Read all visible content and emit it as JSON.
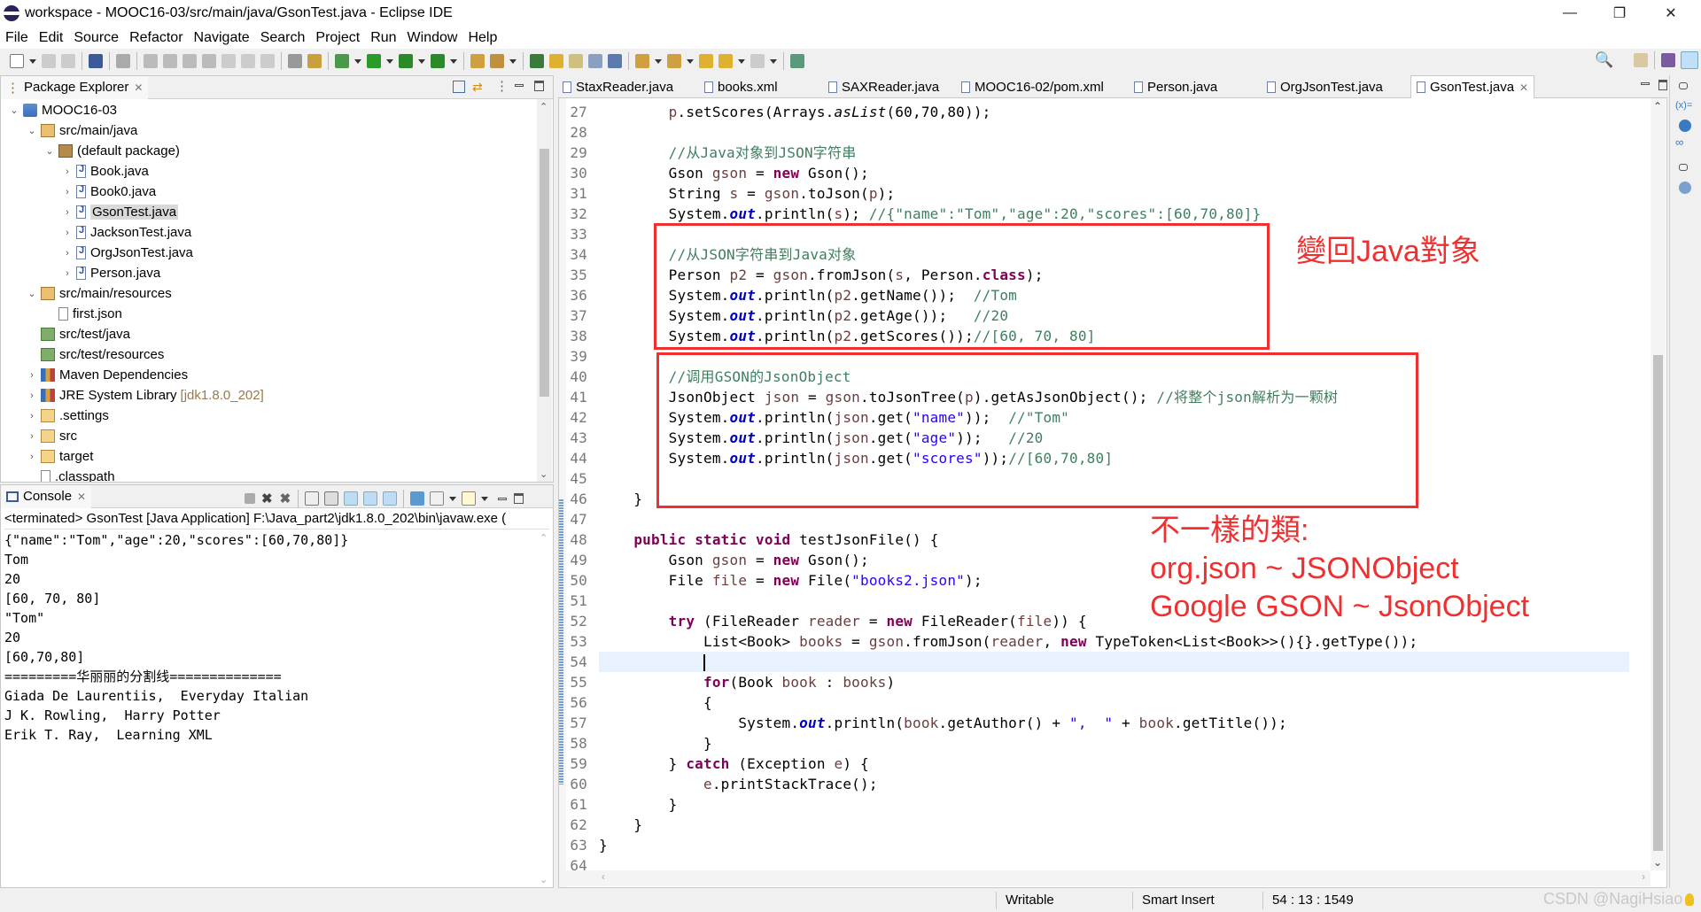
{
  "window": {
    "title": "workspace - MOOC16-03/src/main/java/GsonTest.java - Eclipse IDE",
    "minimize": "—",
    "restore": "❐",
    "close": "✕"
  },
  "menu": [
    "File",
    "Edit",
    "Source",
    "Refactor",
    "Navigate",
    "Search",
    "Project",
    "Run",
    "Window",
    "Help"
  ],
  "package_explorer": {
    "title": "Package Explorer",
    "tree": [
      {
        "label": "MOOC16-03",
        "level": 0,
        "chev": "v",
        "icon": "proj"
      },
      {
        "label": "src/main/java",
        "level": 1,
        "chev": "v",
        "icon": "pkgfolder"
      },
      {
        "label": "(default package)",
        "level": 2,
        "chev": "v",
        "icon": "pkg"
      },
      {
        "label": "Book.java",
        "level": 3,
        "chev": ">",
        "icon": "java"
      },
      {
        "label": "Book0.java",
        "level": 3,
        "chev": ">",
        "icon": "java"
      },
      {
        "label": "GsonTest.java",
        "level": 3,
        "chev": ">",
        "icon": "java",
        "selected": true
      },
      {
        "label": "JacksonTest.java",
        "level": 3,
        "chev": ">",
        "icon": "java"
      },
      {
        "label": "OrgJsonTest.java",
        "level": 3,
        "chev": ">",
        "icon": "java"
      },
      {
        "label": "Person.java",
        "level": 3,
        "chev": ">",
        "icon": "java"
      },
      {
        "label": "src/main/resources",
        "level": 1,
        "chev": "v",
        "icon": "pkgfolder"
      },
      {
        "label": "first.json",
        "level": 2,
        "chev": "",
        "icon": "file"
      },
      {
        "label": "src/test/java",
        "level": 1,
        "chev": "",
        "icon": "testfolder"
      },
      {
        "label": "src/test/resources",
        "level": 1,
        "chev": "",
        "icon": "testfolder"
      },
      {
        "label": "Maven Dependencies",
        "level": 1,
        "chev": ">",
        "icon": "lib"
      },
      {
        "label": "JRE System Library",
        "suffix": "[jdk1.8.0_202]",
        "level": 1,
        "chev": ">",
        "icon": "lib"
      },
      {
        "label": ".settings",
        "level": 1,
        "chev": ">",
        "icon": "folder"
      },
      {
        "label": "src",
        "level": 1,
        "chev": ">",
        "icon": "folder"
      },
      {
        "label": "target",
        "level": 1,
        "chev": ">",
        "icon": "folder"
      },
      {
        "label": ".classpath",
        "level": 1,
        "chev": "",
        "icon": "file"
      }
    ]
  },
  "console": {
    "title": "Console",
    "status": "<terminated> GsonTest [Java Application] F:\\Java_part2\\jdk1.8.0_202\\bin\\javaw.exe  (",
    "lines": [
      "{\"name\":\"Tom\",\"age\":20,\"scores\":[60,70,80]}",
      "Tom",
      "20",
      "[60, 70, 80]",
      "\"Tom\"",
      "20",
      "[60,70,80]",
      "=========华丽丽的分割线==============",
      "Giada De Laurentiis,  Everyday Italian",
      "J K. Rowling,  Harry Potter",
      "Erik T. Ray,  Learning XML"
    ]
  },
  "editor": {
    "tabs": [
      "StaxReader.java",
      "books.xml",
      "SAXReader.java",
      "MOOC16-02/pom.xml",
      "Person.java",
      "OrgJsonTest.java",
      "GsonTest.java"
    ],
    "active_tab": "GsonTest.java",
    "current_line": 54,
    "lines": [
      {
        "n": 27,
        "t": [
          [
            "p",
            "        "
          ],
          [
            "v",
            "p"
          ],
          [
            "p",
            ".setScores(Arrays."
          ],
          [
            "i",
            "asList"
          ],
          [
            "p",
            "(60,70,80));"
          ]
        ]
      },
      {
        "n": 28,
        "t": []
      },
      {
        "n": 29,
        "t": [
          [
            "p",
            "        "
          ],
          [
            "c",
            "//从Java对象到JSON字符串"
          ]
        ]
      },
      {
        "n": 30,
        "t": [
          [
            "p",
            "        Gson "
          ],
          [
            "v",
            "gson"
          ],
          [
            "p",
            " = "
          ],
          [
            "k",
            "new"
          ],
          [
            "p",
            " Gson();"
          ]
        ]
      },
      {
        "n": 31,
        "t": [
          [
            "p",
            "        String "
          ],
          [
            "v",
            "s"
          ],
          [
            "p",
            " = "
          ],
          [
            "v",
            "gson"
          ],
          [
            "p",
            ".toJson("
          ],
          [
            "v",
            "p"
          ],
          [
            "p",
            ");"
          ]
        ]
      },
      {
        "n": 32,
        "t": [
          [
            "p",
            "        System."
          ],
          [
            "f",
            "out"
          ],
          [
            "p",
            ".println("
          ],
          [
            "v",
            "s"
          ],
          [
            "p",
            "); "
          ],
          [
            "c",
            "//{\"name\":\"Tom\",\"age\":20,\"scores\":[60,70,80]}"
          ]
        ]
      },
      {
        "n": 33,
        "t": []
      },
      {
        "n": 34,
        "t": [
          [
            "p",
            "        "
          ],
          [
            "c",
            "//从JSON字符串到Java对象"
          ]
        ]
      },
      {
        "n": 35,
        "t": [
          [
            "p",
            "        Person "
          ],
          [
            "v",
            "p2"
          ],
          [
            "p",
            " = "
          ],
          [
            "v",
            "gson"
          ],
          [
            "p",
            ".fromJson("
          ],
          [
            "v",
            "s"
          ],
          [
            "p",
            ", Person."
          ],
          [
            "k",
            "class"
          ],
          [
            "p",
            ");"
          ]
        ]
      },
      {
        "n": 36,
        "t": [
          [
            "p",
            "        System."
          ],
          [
            "f",
            "out"
          ],
          [
            "p",
            ".println("
          ],
          [
            "v",
            "p2"
          ],
          [
            "p",
            ".getName());  "
          ],
          [
            "c",
            "//Tom"
          ]
        ]
      },
      {
        "n": 37,
        "t": [
          [
            "p",
            "        System."
          ],
          [
            "f",
            "out"
          ],
          [
            "p",
            ".println("
          ],
          [
            "v",
            "p2"
          ],
          [
            "p",
            ".getAge());   "
          ],
          [
            "c",
            "//20"
          ]
        ]
      },
      {
        "n": 38,
        "t": [
          [
            "p",
            "        System."
          ],
          [
            "f",
            "out"
          ],
          [
            "p",
            ".println("
          ],
          [
            "v",
            "p2"
          ],
          [
            "p",
            ".getScores());"
          ],
          [
            "c",
            "//[60, 70, 80]"
          ]
        ]
      },
      {
        "n": 39,
        "t": []
      },
      {
        "n": 40,
        "t": [
          [
            "p",
            "        "
          ],
          [
            "c",
            "//调用GSON的JsonObject"
          ]
        ]
      },
      {
        "n": 41,
        "t": [
          [
            "p",
            "        JsonObject "
          ],
          [
            "v",
            "json"
          ],
          [
            "p",
            " = "
          ],
          [
            "v",
            "gson"
          ],
          [
            "p",
            ".toJsonTree("
          ],
          [
            "v",
            "p"
          ],
          [
            "p",
            ").getAsJsonObject(); "
          ],
          [
            "c",
            "//将整个json解析为一颗树"
          ]
        ]
      },
      {
        "n": 42,
        "t": [
          [
            "p",
            "        System."
          ],
          [
            "f",
            "out"
          ],
          [
            "p",
            ".println("
          ],
          [
            "v",
            "json"
          ],
          [
            "p",
            ".get("
          ],
          [
            "s",
            "\"name\""
          ],
          [
            "p",
            "));  "
          ],
          [
            "c",
            "//\"Tom\""
          ]
        ]
      },
      {
        "n": 43,
        "t": [
          [
            "p",
            "        System."
          ],
          [
            "f",
            "out"
          ],
          [
            "p",
            ".println("
          ],
          [
            "v",
            "json"
          ],
          [
            "p",
            ".get("
          ],
          [
            "s",
            "\"age\""
          ],
          [
            "p",
            "));   "
          ],
          [
            "c",
            "//20"
          ]
        ]
      },
      {
        "n": 44,
        "t": [
          [
            "p",
            "        System."
          ],
          [
            "f",
            "out"
          ],
          [
            "p",
            ".println("
          ],
          [
            "v",
            "json"
          ],
          [
            "p",
            ".get("
          ],
          [
            "s",
            "\"scores\""
          ],
          [
            "p",
            "));"
          ],
          [
            "c",
            "//[60,70,80]"
          ]
        ]
      },
      {
        "n": 45,
        "t": []
      },
      {
        "n": 46,
        "t": [
          [
            "p",
            "    }"
          ]
        ]
      },
      {
        "n": 47,
        "t": []
      },
      {
        "n": 48,
        "t": [
          [
            "p",
            "    "
          ],
          [
            "k",
            "public"
          ],
          [
            "p",
            " "
          ],
          [
            "k",
            "static"
          ],
          [
            "p",
            " "
          ],
          [
            "k",
            "void"
          ],
          [
            "p",
            " testJsonFile() {"
          ]
        ]
      },
      {
        "n": 49,
        "t": [
          [
            "p",
            "        Gson "
          ],
          [
            "v",
            "gson"
          ],
          [
            "p",
            " = "
          ],
          [
            "k",
            "new"
          ],
          [
            "p",
            " Gson();"
          ]
        ]
      },
      {
        "n": 50,
        "t": [
          [
            "p",
            "        File "
          ],
          [
            "v",
            "file"
          ],
          [
            "p",
            " = "
          ],
          [
            "k",
            "new"
          ],
          [
            "p",
            " File("
          ],
          [
            "s",
            "\"books2.json\""
          ],
          [
            "p",
            ");"
          ]
        ]
      },
      {
        "n": 51,
        "t": []
      },
      {
        "n": 52,
        "t": [
          [
            "p",
            "        "
          ],
          [
            "k",
            "try"
          ],
          [
            "p",
            " (FileReader "
          ],
          [
            "v",
            "reader"
          ],
          [
            "p",
            " = "
          ],
          [
            "k",
            "new"
          ],
          [
            "p",
            " FileReader("
          ],
          [
            "v",
            "file"
          ],
          [
            "p",
            ")) {"
          ]
        ]
      },
      {
        "n": 53,
        "t": [
          [
            "p",
            "            List<Book> "
          ],
          [
            "v",
            "books"
          ],
          [
            "p",
            " = "
          ],
          [
            "v",
            "gson"
          ],
          [
            "p",
            ".fromJson("
          ],
          [
            "v",
            "reader"
          ],
          [
            "p",
            ", "
          ],
          [
            "k",
            "new"
          ],
          [
            "p",
            " TypeToken<List<Book>>(){}.getType());"
          ]
        ]
      },
      {
        "n": 54,
        "t": [
          [
            "p",
            "            "
          ]
        ]
      },
      {
        "n": 55,
        "t": [
          [
            "p",
            "            "
          ],
          [
            "k",
            "for"
          ],
          [
            "p",
            "(Book "
          ],
          [
            "v",
            "book"
          ],
          [
            "p",
            " : "
          ],
          [
            "v",
            "books"
          ],
          [
            "p",
            ")"
          ]
        ]
      },
      {
        "n": 56,
        "t": [
          [
            "p",
            "            {"
          ]
        ]
      },
      {
        "n": 57,
        "t": [
          [
            "p",
            "                System."
          ],
          [
            "f",
            "out"
          ],
          [
            "p",
            ".println("
          ],
          [
            "v",
            "book"
          ],
          [
            "p",
            ".getAuthor() + "
          ],
          [
            "s",
            "\",  \""
          ],
          [
            "p",
            " + "
          ],
          [
            "v",
            "book"
          ],
          [
            "p",
            ".getTitle());"
          ]
        ]
      },
      {
        "n": 58,
        "t": [
          [
            "p",
            "            }"
          ]
        ]
      },
      {
        "n": 59,
        "t": [
          [
            "p",
            "        } "
          ],
          [
            "k",
            "catch"
          ],
          [
            "p",
            " (Exception "
          ],
          [
            "v",
            "e"
          ],
          [
            "p",
            ") {"
          ]
        ]
      },
      {
        "n": 60,
        "t": [
          [
            "p",
            "            "
          ],
          [
            "v",
            "e"
          ],
          [
            "p",
            ".printStackTrace();"
          ]
        ]
      },
      {
        "n": 61,
        "t": [
          [
            "p",
            "        }"
          ]
        ]
      },
      {
        "n": 62,
        "t": [
          [
            "p",
            "    }"
          ]
        ]
      },
      {
        "n": 63,
        "t": [
          [
            "p",
            "}"
          ]
        ]
      },
      {
        "n": 64,
        "t": []
      }
    ]
  },
  "annotations": {
    "box1_note": "變回Java對象",
    "box3_lines": [
      "不一樣的類:",
      "org.json ~ JSONObject",
      "Google GSON ~ JsonObject"
    ],
    "color": "#f03030"
  },
  "status_bar": {
    "mode": "Writable",
    "insert": "Smart Insert",
    "position": "54 : 13 : 1549"
  },
  "watermark": "CSDN @NagiHsiao",
  "colors": {
    "keyword": "#7f0055",
    "string": "#2a00ff",
    "comment": "#3f7f5f",
    "field": "#0000c0",
    "variable": "#6a3e3e",
    "current_line": "#e8f2fe"
  }
}
